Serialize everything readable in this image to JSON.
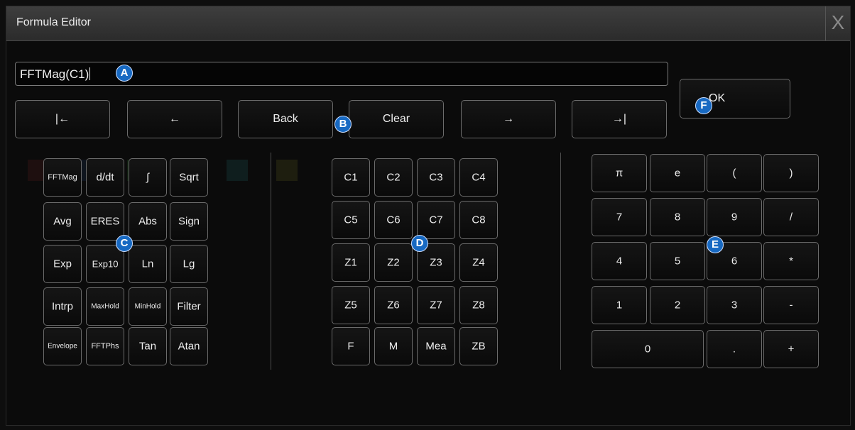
{
  "window": {
    "title": "Formula Editor",
    "close_label": "X"
  },
  "formula": {
    "value": "FFTMag(C1)"
  },
  "nav": [
    {
      "id": "home",
      "label": "|←"
    },
    {
      "id": "left",
      "label": "←"
    },
    {
      "id": "back",
      "label": "Back"
    },
    {
      "id": "clear",
      "label": "Clear"
    },
    {
      "id": "right",
      "label": "→"
    },
    {
      "id": "end",
      "label": "→|"
    }
  ],
  "ok_label": "OK",
  "functions": [
    [
      "FFTMag",
      "d/dt",
      "∫",
      "Sqrt"
    ],
    [
      "Avg",
      "ERES",
      "Abs",
      "Sign"
    ],
    [
      "Exp",
      "Exp10",
      "Ln",
      "Lg"
    ],
    [
      "Intrp",
      "MaxHold",
      "MinHold",
      "Filter"
    ],
    [
      "Envelope",
      "FFTPhs",
      "Tan",
      "Atan"
    ]
  ],
  "sources": [
    [
      "C1",
      "C2",
      "C3",
      "C4"
    ],
    [
      "C5",
      "C6",
      "C7",
      "C8"
    ],
    [
      "Z1",
      "Z2",
      "Z3",
      "Z4"
    ],
    [
      "Z5",
      "Z6",
      "Z7",
      "Z8"
    ],
    [
      "F",
      "M",
      "Mea",
      "ZB"
    ]
  ],
  "numpad": [
    [
      "π",
      "e",
      "(",
      ")"
    ],
    [
      "7",
      "8",
      "9",
      "/"
    ],
    [
      "4",
      "5",
      "6",
      "*"
    ],
    [
      "1",
      "2",
      "3",
      "-"
    ],
    [
      "0",
      ".",
      "+"
    ]
  ],
  "markers": [
    "A",
    "B",
    "C",
    "D",
    "E",
    "F"
  ],
  "colors": {
    "marker": "#1769c2",
    "background": "#0b0b0b",
    "key_border": "#6b6b6b"
  }
}
